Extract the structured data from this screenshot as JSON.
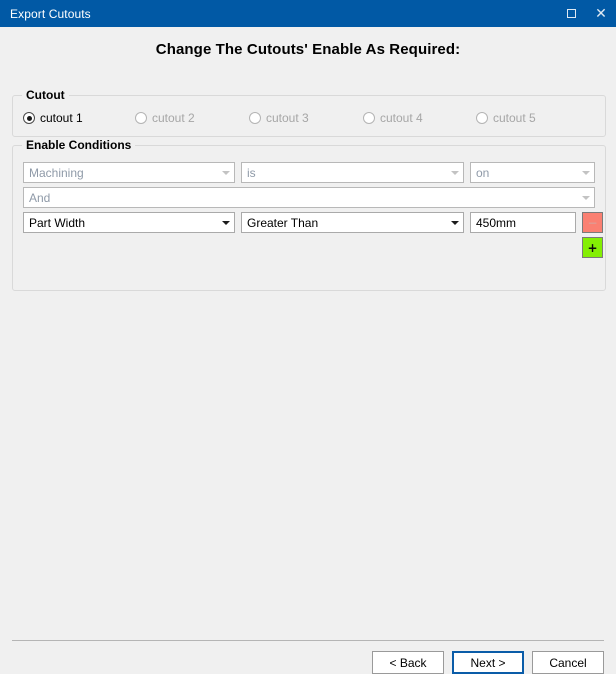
{
  "window": {
    "title": "Export Cutouts",
    "maximize_icon": "maximize-icon",
    "close_icon": "close-icon"
  },
  "page": {
    "title": "Change The Cutouts' Enable As Required:"
  },
  "cutout_group": {
    "legend": "Cutout",
    "options": [
      {
        "label": "cutout 1",
        "selected": true,
        "enabled": true
      },
      {
        "label": "cutout 2",
        "selected": false,
        "enabled": false
      },
      {
        "label": "cutout 3",
        "selected": false,
        "enabled": false
      },
      {
        "label": "cutout 4",
        "selected": false,
        "enabled": false
      },
      {
        "label": "cutout 5",
        "selected": false,
        "enabled": false
      }
    ]
  },
  "conditions_group": {
    "legend": "Enable Conditions",
    "rows": [
      {
        "subject": "Machining",
        "operator": "is",
        "value": "on",
        "enabled": false
      },
      {
        "joiner": "And",
        "enabled": false
      },
      {
        "subject": "Part Width",
        "operator": "Greater Than",
        "value": "450mm",
        "enabled": true
      }
    ],
    "remove_button_label": "−",
    "add_button_label": "+"
  },
  "footer": {
    "back_label": "< Back",
    "next_label": "Next >",
    "cancel_label": "Cancel"
  },
  "colors": {
    "titlebar": "#0159a5",
    "remove_button": "#fa8072",
    "add_button": "#84ef04",
    "default_button_border": "#0a5ca8"
  }
}
